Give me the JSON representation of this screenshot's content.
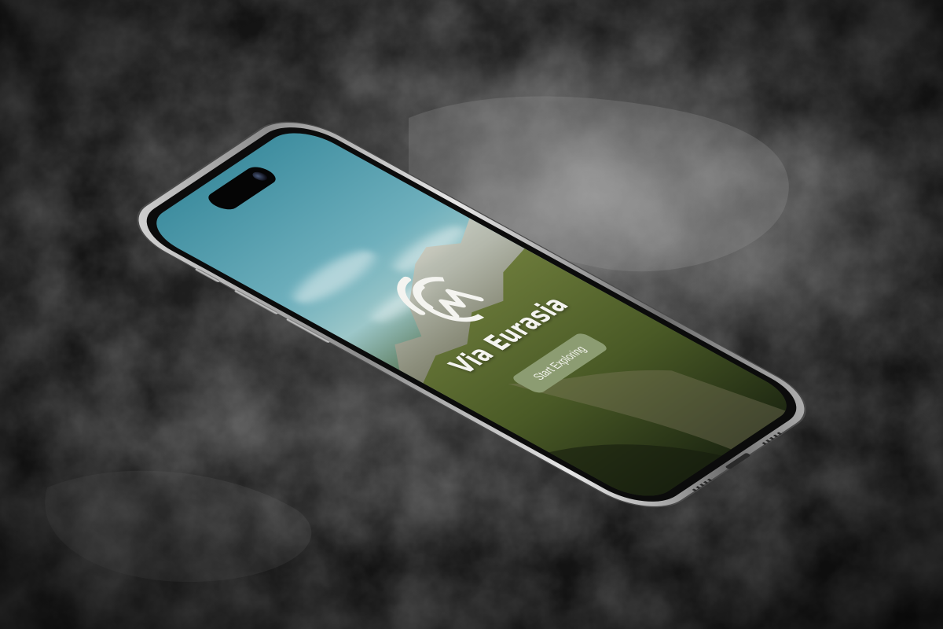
{
  "app": {
    "title": "Via Eurasia",
    "cta_label": "Start Exploring"
  },
  "icons": {
    "logo": "via-eurasia-logo-icon",
    "camera": "front-camera-icon"
  },
  "colors": {
    "background_rock": "#3a3a3a",
    "phone_frame": "#b8b8b8",
    "sky": "#6fb0bd",
    "grass": "#3e5a32",
    "cta_button": "#8c9c72",
    "title_text": "#f4f4f0"
  }
}
